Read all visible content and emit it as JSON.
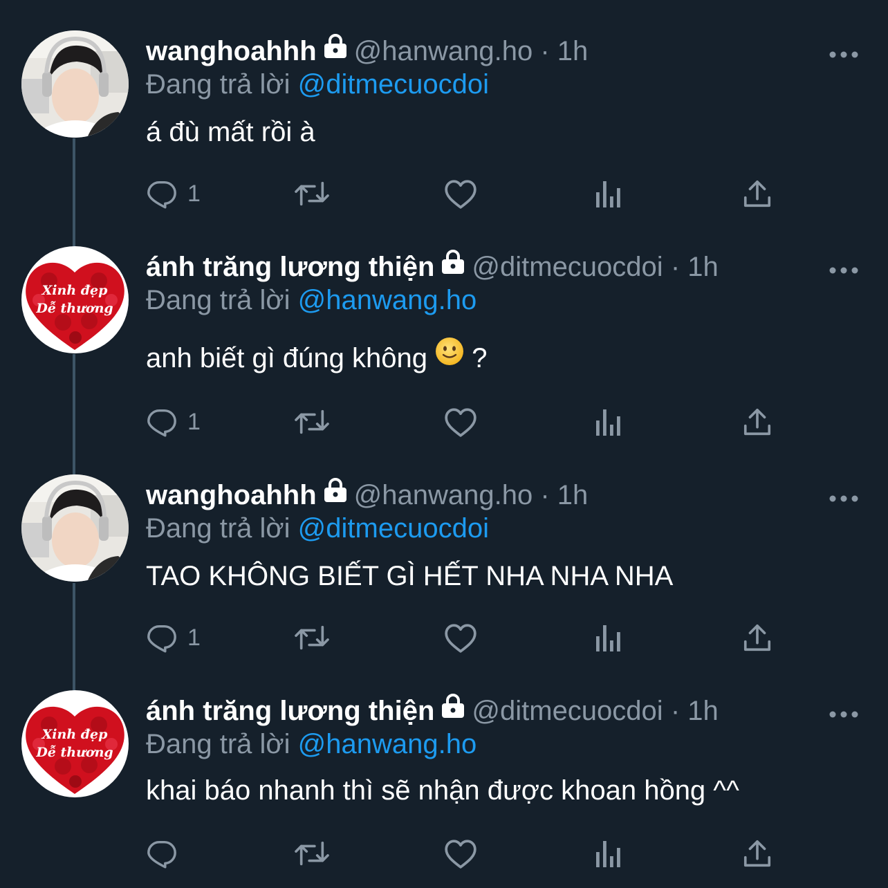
{
  "tweets": [
    {
      "display_name": "wanghoahhh",
      "handle": "@hanwang.ho",
      "dot": "·",
      "time": "1h",
      "replying_prefix": "Đang trả lời",
      "replying_to": "@ditmecuocdoi",
      "text": "á đù mất rồi à",
      "reply_count": "1",
      "avatar": "photo-boy-headphones"
    },
    {
      "display_name": "ánh trăng lương thiện",
      "handle": "@ditmecuocdoi",
      "dot": "·",
      "time": "1h",
      "replying_prefix": "Đang trả lời",
      "replying_to": "@hanwang.ho",
      "text": "anh biết gì đúng không",
      "text_suffix": "?",
      "emoji": "slightly-smiling-face",
      "reply_count": "1",
      "avatar": "red-heart-roses",
      "avatar_text_1": "Xinh đẹp",
      "avatar_text_2": "Dễ thương"
    },
    {
      "display_name": "wanghoahhh",
      "handle": "@hanwang.ho",
      "dot": "·",
      "time": "1h",
      "replying_prefix": "Đang trả lời",
      "replying_to": "@ditmecuocdoi",
      "text": "TAO KHÔNG BIẾT GÌ HẾT NHA NHA NHA",
      "reply_count": "1",
      "avatar": "photo-boy-headphones"
    },
    {
      "display_name": "ánh trăng lương thiện",
      "handle": "@ditmecuocdoi",
      "dot": "·",
      "time": "1h",
      "replying_prefix": "Đang trả lời",
      "replying_to": "@hanwang.ho",
      "text": "khai báo nhanh thì sẽ nhận được khoan hồng ^^",
      "reply_count": "",
      "avatar": "red-heart-roses",
      "avatar_text_1": "Xinh đẹp",
      "avatar_text_2": "Dễ thương"
    }
  ],
  "icons": {
    "reply": "reply-icon",
    "retweet": "retweet-icon",
    "like": "like-icon",
    "analytics": "analytics-icon",
    "share": "share-icon",
    "more": "more-icon",
    "lock": "lock-icon"
  },
  "colors": {
    "background": "#15202b",
    "text": "#ffffff",
    "secondary": "#8b98a5",
    "link": "#1d9bf0"
  }
}
